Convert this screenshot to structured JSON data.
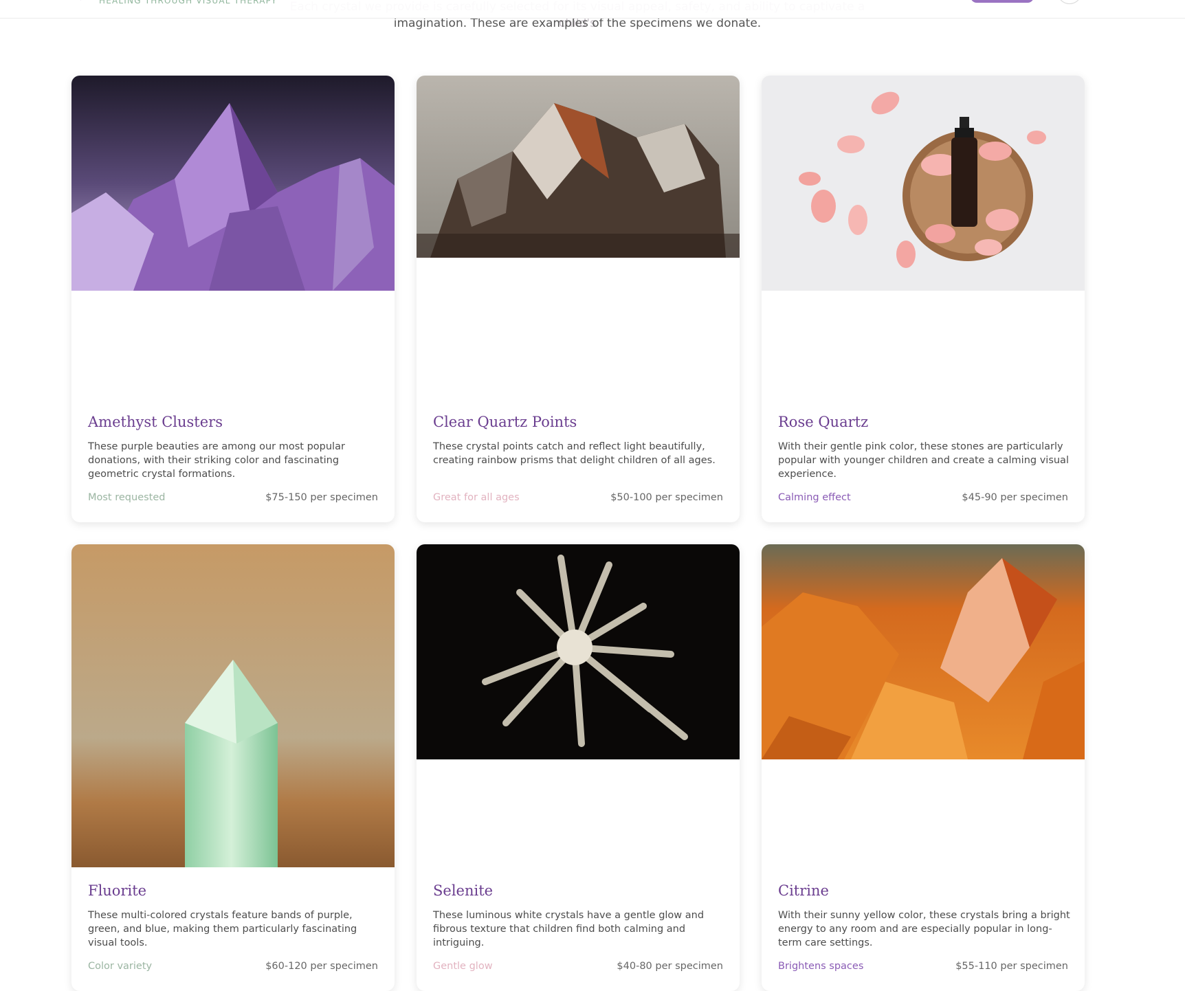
{
  "header": {
    "tagline": "HEALING THROUGH VISUAL THERAPY"
  },
  "intro": {
    "line1": "Each crystal we provide is carefully selected for its visual appeal, safety, and ability to captivate a child's",
    "line2": "imagination. These are examples of the specimens we donate."
  },
  "colors": {
    "title": "#6a3d8f",
    "tag_green": "#9bb5a2",
    "tag_pink": "#e2b3c0",
    "tag_purple": "#8a5bb5"
  },
  "cards": [
    {
      "title": "Amethyst Clusters",
      "description": "These purple beauties are among our most popular donations, with their striking color and fascinating geometric crystal formations.",
      "tag": "Most requested",
      "tag_color": "#9bb5a2",
      "price": "$75-150 per specimen",
      "image": "amethyst-crystal-photo"
    },
    {
      "title": "Clear Quartz Points",
      "description": "These crystal points catch and reflect light beautifully, creating rainbow prisms that delight children of all ages.",
      "tag": "Great for all ages",
      "tag_color": "#e2b3c0",
      "price": "$50-100 per specimen",
      "image": "quartz-crystal-photo"
    },
    {
      "title": "Rose Quartz",
      "description": "With their gentle pink color, these stones are particularly popular with younger children and create a calming visual experience.",
      "tag": "Calming effect",
      "tag_color": "#8a5bb5",
      "price": "$45-90 per specimen",
      "image": "rose-petals-bottle-photo"
    },
    {
      "title": "Fluorite",
      "description": "These multi-colored crystals feature bands of purple, green, and blue, making them particularly fascinating visual tools.",
      "tag": "Color variety",
      "tag_color": "#9bb5a2",
      "price": "$60-120 per specimen",
      "image": "green-fluorite-point-photo"
    },
    {
      "title": "Selenite",
      "description": "These luminous white crystals have a gentle glow and fibrous texture that children find both calming and intriguing.",
      "tag": "Gentle glow",
      "tag_color": "#e2b3c0",
      "price": "$40-80 per specimen",
      "image": "selenite-cluster-photo"
    },
    {
      "title": "Citrine",
      "description": "With their sunny yellow color, these crystals bring a bright energy to any room and are especially popular in long-term care settings.",
      "tag": "Brightens spaces",
      "tag_color": "#8a5bb5",
      "price": "$55-110 per specimen",
      "image": "citrine-crystal-photo"
    }
  ]
}
